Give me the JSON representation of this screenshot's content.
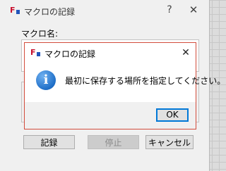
{
  "outer_dialog": {
    "title": "マクロの記録",
    "help_glyph": "?",
    "close_glyph": "✕",
    "macro_name_label": "マクロ名:",
    "buttons": {
      "record": "記録",
      "stop": "停止",
      "cancel": "キャンセル"
    }
  },
  "message_box": {
    "title": "マクロの記録",
    "close_glyph": "✕",
    "icon": "information-icon",
    "message": "最初に保存する場所を指定してください。",
    "ok_label": "OK"
  },
  "colors": {
    "modal_border": "#d24c3c",
    "app_icon_red": "#c8102e",
    "info_icon_blue": "#1f6fc8",
    "focus_blue": "#0078d7"
  }
}
